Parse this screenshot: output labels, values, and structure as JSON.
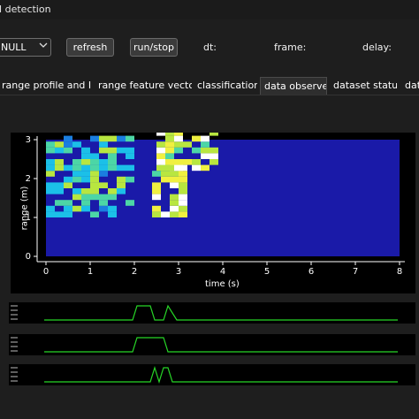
{
  "window": {
    "title": "ll detection"
  },
  "toolbar": {
    "source_select": "NULL",
    "refresh_label": "refresh",
    "run_stop_label": "run/stop",
    "dt_label": "dt:",
    "frame_label": "frame:",
    "delay_label": "delay:"
  },
  "tabs": [
    {
      "label": "range profile and IF"
    },
    {
      "label": "range feature vector"
    },
    {
      "label": "classification"
    },
    {
      "label": "data observe",
      "active": true
    },
    {
      "label": "dataset status"
    },
    {
      "label": "dat"
    }
  ],
  "chart_data": [
    {
      "type": "heatmap",
      "xlabel": "time (s)",
      "ylabel": "range (m)",
      "xlim": [
        0,
        8
      ],
      "ylim": [
        0,
        3
      ],
      "xticks": [
        0,
        1,
        2,
        3,
        4,
        5,
        6,
        7,
        8
      ],
      "yticks": [
        0,
        1,
        2,
        3
      ],
      "colormap": "jet",
      "background_color": "#1a1aa8",
      "hot_regions": [
        {
          "t": [
            0.0,
            1.8
          ],
          "r": [
            1.0,
            3.0
          ],
          "intensity": "mixed cyan/yellow"
        },
        {
          "t": [
            2.4,
            3.2
          ],
          "r": [
            1.0,
            2.2
          ],
          "intensity": "high (white/yellow)"
        },
        {
          "t": [
            2.5,
            3.8
          ],
          "r": [
            2.2,
            3.2
          ],
          "intensity": "high (white/yellow)"
        }
      ]
    },
    {
      "type": "line",
      "name": "strip1",
      "x": [
        0,
        2.0,
        2.1,
        2.4,
        2.5,
        2.7,
        2.8,
        3.0,
        8
      ],
      "y": [
        0,
        0,
        1,
        1,
        0,
        0,
        1,
        0,
        0
      ],
      "color": "#27d727"
    },
    {
      "type": "line",
      "name": "strip2",
      "x": [
        0,
        2.0,
        2.1,
        2.7,
        2.8,
        8
      ],
      "y": [
        0,
        0,
        1,
        1,
        0,
        0
      ],
      "color": "#27d727"
    },
    {
      "type": "line",
      "name": "strip3",
      "x": [
        0,
        2.4,
        2.5,
        2.6,
        2.7,
        2.8,
        2.9,
        8
      ],
      "y": [
        0,
        0,
        1,
        0,
        1,
        1,
        0,
        0
      ],
      "color": "#27d727"
    }
  ]
}
